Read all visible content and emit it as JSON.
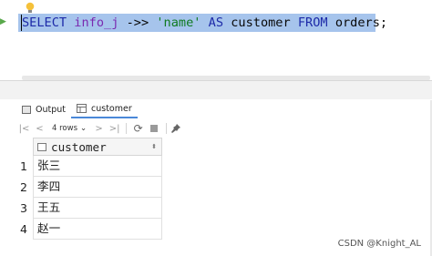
{
  "editor": {
    "code": {
      "select_kw": "SELECT",
      "col": "info_j",
      "op": "->>",
      "str": "'name'",
      "as_kw": "AS",
      "alias": "customer",
      "from_kw": "FROM",
      "table": "orders;"
    }
  },
  "tabs": [
    {
      "label": "Output",
      "icon": "output-icon"
    },
    {
      "label": "customer",
      "icon": "table-icon"
    }
  ],
  "toolbar": {
    "first": "|<",
    "prev": "<",
    "rows_label": "4 rows",
    "rows_arrow": "⌄",
    "next": ">",
    "last": ">|",
    "refresh": "⟳",
    "pin": "📌"
  },
  "grid": {
    "column": "customer",
    "sort_glyph": "⬍",
    "rows": [
      {
        "num": "1",
        "value": "张三"
      },
      {
        "num": "2",
        "value": "李四"
      },
      {
        "num": "3",
        "value": "王五"
      },
      {
        "num": "4",
        "value": "赵一"
      }
    ]
  },
  "watermark": "CSDN @Knight_AL",
  "colors": {
    "selection": "#a6c4ec",
    "keyword": "#1d2aa8",
    "string": "#0f7a1f",
    "identifier": "#7a2ab0",
    "tab_underline": "#4a88d8"
  }
}
